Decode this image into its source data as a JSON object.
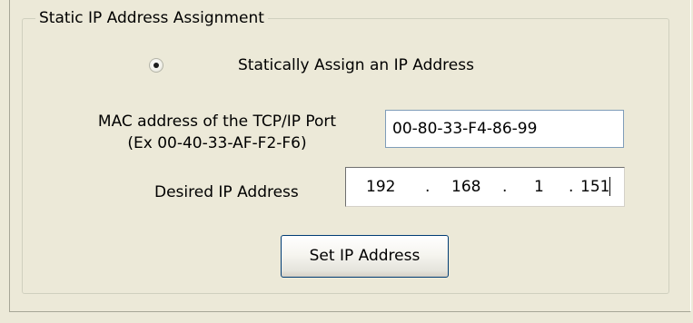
{
  "group": {
    "title": "Static IP Address Assignment"
  },
  "radio": {
    "label": "Statically Assign an IP Address",
    "checked": true
  },
  "mac": {
    "label_line1": "MAC address of the TCP/IP Port",
    "label_line2": "(Ex 00-40-33-AF-F2-F6)",
    "value": "00-80-33-F4-86-99"
  },
  "ip": {
    "label": "Desired IP Address",
    "octets": [
      "192",
      "168",
      "1",
      "151"
    ],
    "separator": "."
  },
  "button": {
    "label": "Set IP Address"
  }
}
